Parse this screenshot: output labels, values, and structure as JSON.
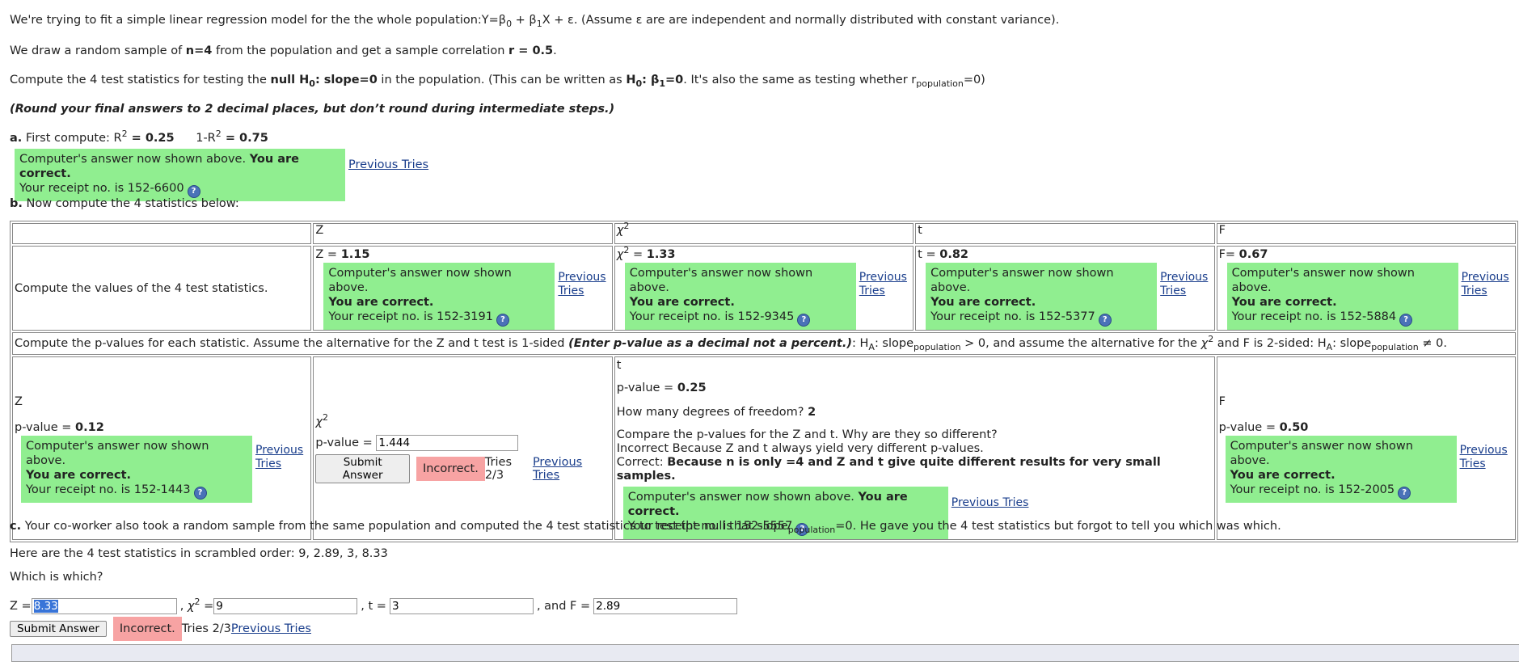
{
  "intro": {
    "l1_a": "We're trying to fit a simple linear regression model for the the whole population:Y=β",
    "l1_b": " + β",
    "l1_c": "X + ε. (Assume ε are are independent and normally distributed with constant variance).",
    "sub0": "0",
    "sub1": "1",
    "l2_a": "We draw a random sample of ",
    "l2_n": "n=4",
    "l2_b": " from the population and get a sample correlation ",
    "l2_r": "r = 0.5",
    "l2_c": ".",
    "l3_a": "Compute the 4 test statistics for testing the ",
    "l3_null": "null H",
    "l3_null2": ": slope=0",
    "l3_b": " in the population. (This can be written as ",
    "l3_h": "H",
    "l3_h2": ": β",
    "l3_h3": "=0",
    "l3_c": ". It's also the same as testing whether r",
    "l3_pop": "population",
    "l3_d": "=0)",
    "round": "(Round your final answers to 2 decimal places, but don’t round during intermediate steps.)"
  },
  "part_a": {
    "label": "a.",
    "text": " First compute: R",
    "r2": " = 0.25",
    "one": "1-R",
    "one_r2": " = 0.75",
    "sup2": "2",
    "fb1": "Computer's answer now shown above. ",
    "fb2": "You are correct.",
    "receipt": "Your receipt no. is 152-6600",
    "prev": "Previous Tries"
  },
  "part_b": {
    "label": "b.",
    "text": " Now compute the 4 statistics below:",
    "headers": [
      "Z",
      "χ",
      "t",
      "F"
    ],
    "row1_label": "Compute the values of the 4 test statistics.",
    "stats": [
      {
        "label": "Z = ",
        "value": "1.15",
        "receipt": "Your receipt no. is 152-3191"
      },
      {
        "label": " = ",
        "value": "1.33",
        "receipt": "Your receipt no. is 152-9345"
      },
      {
        "label": "t = ",
        "value": "0.82",
        "receipt": "Your receipt no. is 152-5377"
      },
      {
        "label": "F= ",
        "value": "0.67",
        "receipt": "Your receipt no. is 152-5884"
      }
    ],
    "fb_shown": "Computer's answer now shown above.",
    "fb_correct": "You are correct.",
    "prev1": "Previous",
    "prev2": "Tries",
    "pv_a": "Compute the p-values for each statistic. Assume the alternative for the Z and t test is 1-sided ",
    "pv_it": "(Enter p-value as a decimal not a percent.)",
    "pv_b": ": H",
    "pv_A": "A",
    "pv_c": ": slope",
    "pv_d": " > 0, and assume the alternative for the ",
    "pv_e": " and F is 2-sided: H",
    "pv_f": " ≠ 0.",
    "z_pv_label": "p-value = ",
    "z_pv": "0.12",
    "z_receipt": "Your receipt no. is 152-1443",
    "chi_pv_label": "p-value = ",
    "chi_pv_input": "1.444",
    "submit": "Submit Answer",
    "incorrect": "Incorrect.",
    "tries": " Tries 2/3 ",
    "prev_tries": "Previous Tries",
    "t_pv_label": "p-value = ",
    "t_pv": "0.25",
    "df_q": "How many degrees of freedom? ",
    "df": "2",
    "cmp_q": "Compare the p-values for the Z and t. Why are they so different?",
    "cmp_wrong": "Incorrect Because Z and t always yield very different p-values.",
    "cmp_correct_label": "Correct: ",
    "cmp_correct": "Because n is only =4 and Z and t give quite different results for very small samples.",
    "t_fb1": "Computer's answer now shown above. ",
    "t_fb2": "You are correct.",
    "t_receipt": "Your receipt no. is 152-5557",
    "f_pv_label": "p-value = ",
    "f_pv": "0.50",
    "f_receipt": "Your receipt no. is 152-2005"
  },
  "part_c": {
    "label": "c.",
    "text_a": " Your co-worker also took a random sample from the same population and computed the 4 test statistics to test the null that slope",
    "text_b": "=0. He gave you the 4 test statistics but forgot to tell you which was which.",
    "scrambled": "Here are the 4 test statistics in scrambled order: 9, 2.89, 3, 8.33",
    "which": "Which is which?",
    "z_label": "Z = ",
    "z_val": "8.33",
    "chi_label": " = ",
    "chi_val": "9",
    "t_label": ", t = ",
    "t_val": "3",
    "f_label": ", and F = ",
    "f_val": "2.89",
    "submit": "Submit Answer",
    "incorrect": "Incorrect.",
    "tries": " Tries 2/3 ",
    "prev_tries": "Previous Tries"
  },
  "colors": {
    "correct_bg": "#90ee90",
    "incorrect_bg": "#f7a3a3",
    "link": "#1a3e8c"
  }
}
